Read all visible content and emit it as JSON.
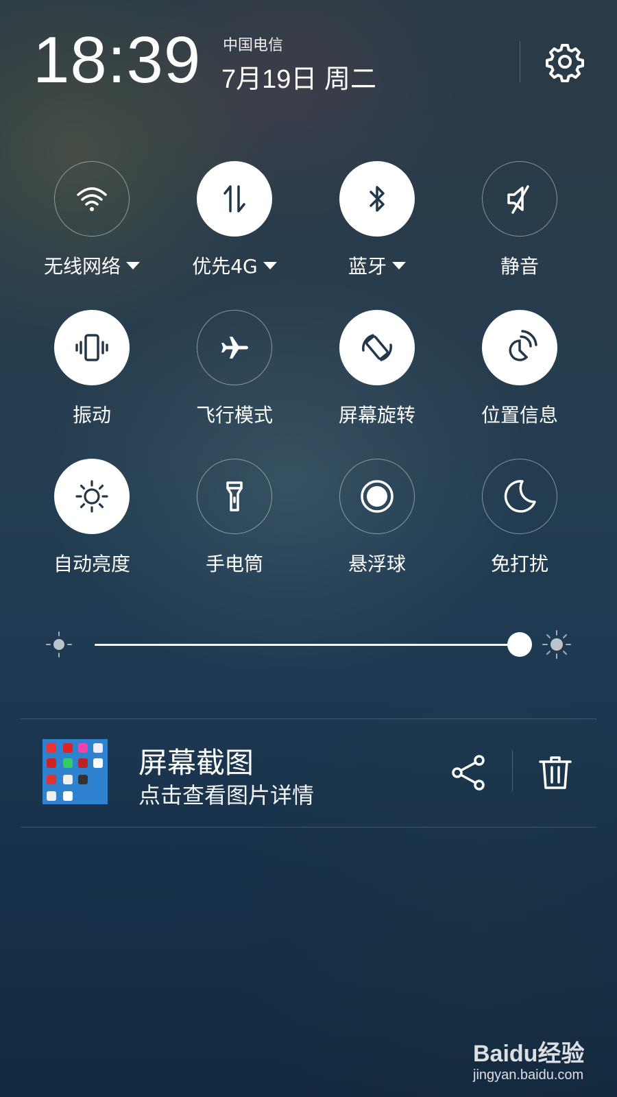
{
  "status": {
    "time": "18:39",
    "carrier": "中国电信",
    "date": "7月19日 周二"
  },
  "toggles": [
    {
      "label": "无线网络",
      "icon": "wifi-icon",
      "active": false,
      "dropdown": true
    },
    {
      "label": "优先4G",
      "icon": "mobile-data-icon",
      "active": true,
      "dropdown": true
    },
    {
      "label": "蓝牙",
      "icon": "bluetooth-icon",
      "active": true,
      "dropdown": true
    },
    {
      "label": "静音",
      "icon": "mute-icon",
      "active": false,
      "dropdown": false
    },
    {
      "label": "振动",
      "icon": "vibrate-icon",
      "active": true,
      "dropdown": false
    },
    {
      "label": "飞行模式",
      "icon": "airplane-icon",
      "active": false,
      "dropdown": false
    },
    {
      "label": "屏幕旋转",
      "icon": "rotate-icon",
      "active": true,
      "dropdown": false
    },
    {
      "label": "位置信息",
      "icon": "location-icon",
      "active": true,
      "dropdown": false
    },
    {
      "label": "自动亮度",
      "icon": "auto-brightness-icon",
      "active": true,
      "dropdown": false
    },
    {
      "label": "手电筒",
      "icon": "flashlight-icon",
      "active": false,
      "dropdown": false
    },
    {
      "label": "悬浮球",
      "icon": "floating-ball-icon",
      "active": false,
      "dropdown": false
    },
    {
      "label": "免打扰",
      "icon": "moon-icon",
      "active": false,
      "dropdown": false
    }
  ],
  "brightness": {
    "level": 1.0
  },
  "notification": {
    "title": "屏幕截图",
    "subtitle": "点击查看图片详情"
  },
  "watermark": {
    "brand": "Baidu经验",
    "url": "jingyan.baidu.com"
  },
  "colors": {
    "active_circle": "#ffffff",
    "active_icon": "#22384a"
  }
}
